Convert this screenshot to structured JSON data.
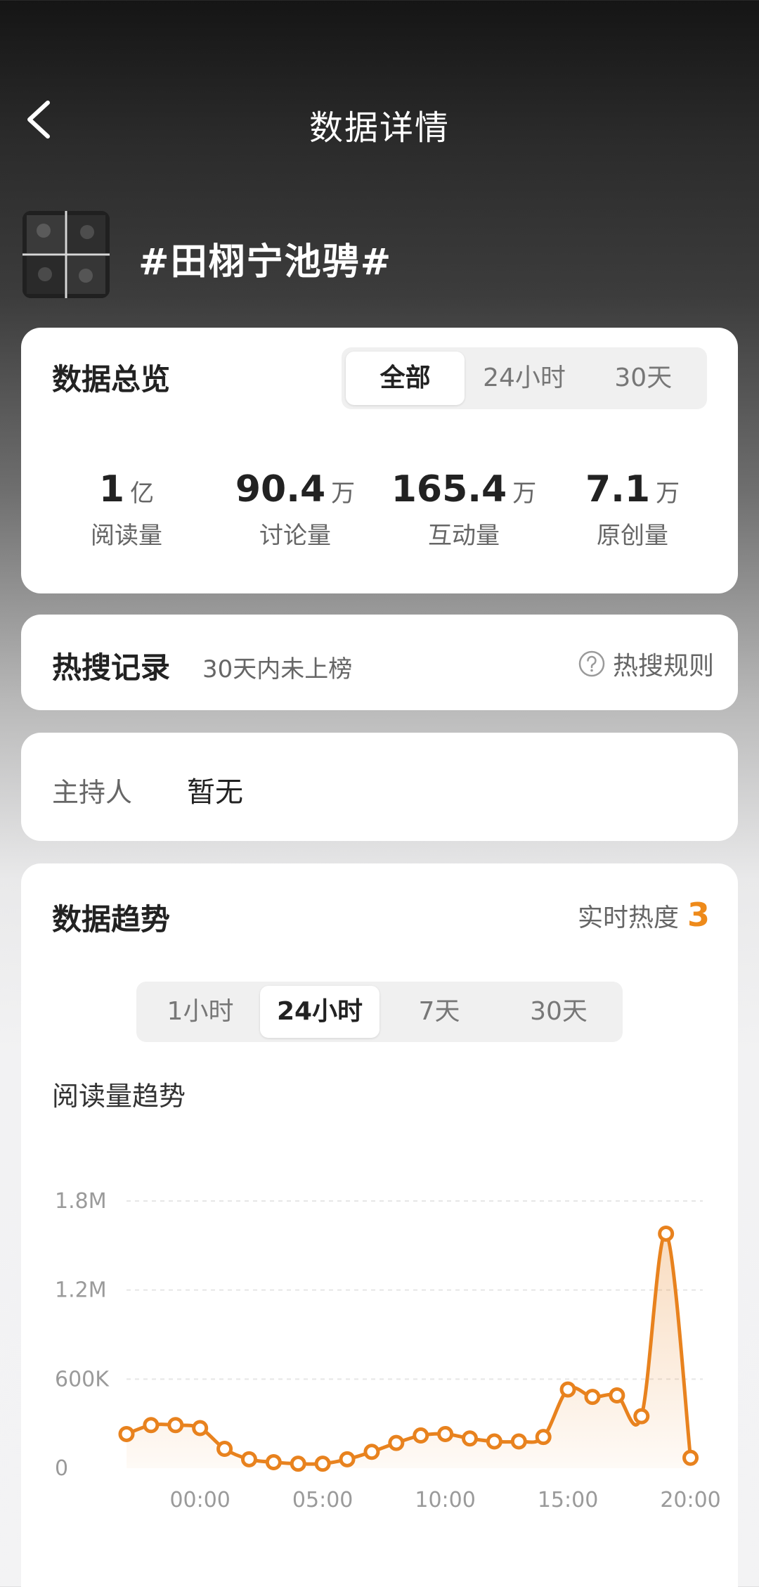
{
  "header": {
    "title": "数据详情"
  },
  "topic": {
    "title": "#田栩宁池骋#"
  },
  "overview": {
    "title": "数据总览",
    "tabs": [
      {
        "label": "全部",
        "active": true
      },
      {
        "label": "24小时",
        "active": false
      },
      {
        "label": "30天",
        "active": false
      }
    ],
    "stats": [
      {
        "value": "1",
        "unit": "亿",
        "label": "阅读量"
      },
      {
        "value": "90.4",
        "unit": "万",
        "label": "讨论量"
      },
      {
        "value": "165.4",
        "unit": "万",
        "label": "互动量"
      },
      {
        "value": "7.1",
        "unit": "万",
        "label": "原创量"
      }
    ]
  },
  "hot_search": {
    "title": "热搜记录",
    "status": "30天内未上榜",
    "rules_label": "热搜规则"
  },
  "host": {
    "label": "主持人",
    "value": "暂无"
  },
  "trend": {
    "title": "数据趋势",
    "heat_label": "实时热度",
    "heat_value": "3",
    "tabs": [
      {
        "label": "1小时",
        "active": false
      },
      {
        "label": "24小时",
        "active": true
      },
      {
        "label": "7天",
        "active": false
      },
      {
        "label": "30天",
        "active": false
      }
    ],
    "chart_title": "阅读量趋势"
  },
  "colors": {
    "accent": "#ee8a1a",
    "line": "#e8821e",
    "fill": "#fdebd6"
  },
  "chart_data": {
    "type": "area",
    "title": "阅读量趋势",
    "xlabel": "",
    "ylabel": "",
    "ylim": [
      0,
      1800000
    ],
    "y_ticks": [
      "0",
      "600K",
      "1.2M",
      "1.8M"
    ],
    "y_tick_values": [
      0,
      600000,
      1200000,
      1800000
    ],
    "x_ticks": [
      "00:00",
      "05:00",
      "10:00",
      "15:00",
      "20:00"
    ],
    "x_tick_values": [
      0,
      5,
      10,
      15,
      20
    ],
    "xlim": [
      -3,
      20.5
    ],
    "grid": true,
    "series": [
      {
        "x": [
          -3,
          -2,
          -1,
          0,
          1,
          2,
          3,
          4,
          5,
          6,
          7,
          8,
          9,
          10,
          11,
          12,
          13,
          14,
          15,
          16,
          17,
          18,
          19,
          20
        ],
        "values": [
          230000,
          290000,
          290000,
          270000,
          130000,
          60000,
          40000,
          30000,
          30000,
          60000,
          110000,
          170000,
          220000,
          230000,
          200000,
          180000,
          180000,
          210000,
          530000,
          480000,
          490000,
          350000,
          1580000,
          70000
        ]
      }
    ]
  }
}
